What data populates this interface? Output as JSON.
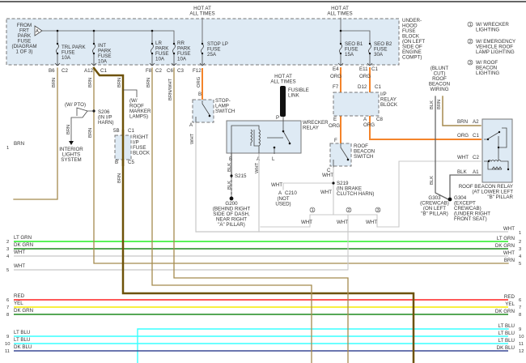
{
  "colors": {
    "brn": "#a58a4e",
    "brn_thick": "#6e5208",
    "org": "#f4842a",
    "wht": "#c8c8c8",
    "lt_grn": "#22ee22",
    "dk_grn": "#1f8a1f",
    "red": "#ff2020",
    "yel": "#f6ea00",
    "lt_blu": "#38ffff",
    "dk_blu": "#3a4896",
    "blk": "#555555",
    "box_fill": "#deeaf4"
  },
  "hot_labels": {
    "stop": [
      "HOT AT",
      "ALL TIMES"
    ],
    "seo": [
      "HOT AT",
      "ALL TIMES"
    ],
    "fusible": [
      "HOT AT",
      "ALL TIMES"
    ]
  },
  "fuse_block": {
    "from_label": [
      "FROM",
      "FRT",
      "PARK",
      "FUSE",
      "(DIAGRAM",
      "1 OF 3)"
    ],
    "triangle": "A",
    "underhood_label": [
      "UNDER-",
      "HOOD",
      "FUSE",
      "BLOCK",
      "(ON LEFT",
      "SIDE OF",
      "ENGINE",
      "COMPT)"
    ],
    "fuses": {
      "trl": [
        "TRL PARK",
        "FUSE",
        "10A"
      ],
      "int": [
        "INT",
        "PARK",
        "FUSE",
        "10A"
      ],
      "lr": [
        "LR",
        "PARK",
        "FUSE",
        "10A"
      ],
      "rr": [
        "RR",
        "PARK",
        "FUSE",
        "10A"
      ],
      "stop": [
        "STOP LP",
        "FUSE",
        "25A"
      ],
      "seo_b1": [
        "SEO B1",
        "FUSE",
        "15A"
      ],
      "seo_b2": [
        "SEO B2",
        "FUSE",
        "30A"
      ]
    },
    "pins": {
      "trl": [
        "B6",
        "C2"
      ],
      "int": [
        "A12",
        "C1"
      ],
      "lr": [
        "F8",
        "C2"
      ],
      "rr": [
        "C6",
        "C3"
      ],
      "stop": "F12",
      "seo_b1": "E4",
      "seo_b2": [
        "E11",
        "C1"
      ]
    }
  },
  "legend": [
    {
      "num": "1",
      "text": [
        "W/ WRECKER",
        "LIGHTING"
      ]
    },
    {
      "num": "2",
      "text": [
        "W/ EMERGENCY",
        "VEHICLE ROOF",
        "LAMP LIGHTING"
      ]
    },
    {
      "num": "3",
      "text": [
        "W/ ROOF",
        "BEACON",
        "LIGHTING"
      ]
    }
  ],
  "wire_labels": {
    "brn": "BRN",
    "brn_wht": "BRN/WHT",
    "org": "ORG",
    "wht": "WHT",
    "blk": "BLK"
  },
  "components": {
    "w_pto": "(W/ PTO)",
    "s206": [
      "S206",
      "(IN I/P",
      "HARN)"
    ],
    "interior": [
      "INTERIOR",
      "LIGHTS",
      "SYSTEM"
    ],
    "roof_marker": [
      "(W/",
      "ROOF",
      "MARKER",
      "LAMPS)"
    ],
    "right_ip_fuse": [
      "RIGHT",
      "I/P",
      "FUSE",
      "BLOCK"
    ],
    "right_ip_pins": [
      "5B",
      "C1",
      "B",
      "C5"
    ],
    "stop_lamp_switch": [
      "STOP-",
      "LAMP",
      "SWITCH"
    ],
    "stop_pins": [
      "B",
      "A"
    ],
    "fusible_link": [
      "FUSIBLE",
      "LINK"
    ],
    "fusible_pin": "P",
    "wrecker_relay": [
      "WRECKER",
      "RELAY"
    ],
    "wrecker_pins": [
      "B",
      "A",
      "L"
    ],
    "s215": "S215",
    "g200": [
      "G200",
      "(BEHIND RIGHT",
      "SIDE OF DASH,",
      "NEAR RIGHT",
      "\"A\" PILLAR)"
    ],
    "ip_relay_block": [
      "I/P",
      "RELAY",
      "BLOCK"
    ],
    "ip_relay_pins": [
      "F7",
      "D12",
      "C1",
      "E",
      "A",
      "C8"
    ],
    "roof_beacon_switch": [
      "ROOF",
      "BEACON",
      "SWITCH"
    ],
    "beacon_switch_pins": [
      "F",
      "C"
    ],
    "s219": [
      "S219",
      "(IN BRAKE",
      "CLUTCH HARN)"
    ],
    "c210": [
      "A",
      "C210",
      "(NOT",
      "USED)"
    ],
    "branch_nums": [
      "1",
      "2",
      "3"
    ],
    "blunt_cut": [
      "(BLUNT",
      "CUT)",
      "ROOF",
      "BEACON",
      "WIRING"
    ],
    "roof_beacon_relay": [
      "ROOF BEACON RELAY",
      "(AT LOWER LEFT",
      "\"B\" PILLAR"
    ],
    "relay_pins": [
      "A2",
      "C1",
      "C2",
      "A1"
    ],
    "g303": [
      "G303",
      "(CREWCAB)",
      "(ON LEFT",
      "\"B\" PILLAR)"
    ],
    "g304": [
      "G304",
      "(EXCEPT",
      "CREWCAB)",
      "(UNDER RIGHT",
      "FRONT SEAT)"
    ]
  },
  "bus_left": [
    {
      "num": "1",
      "color": "BRN"
    },
    {
      "num": "2",
      "color": "LT GRN"
    },
    {
      "num": "3",
      "color": "DK GRN"
    },
    {
      "num": "4",
      "color": "WHT"
    },
    {
      "num": "5",
      "color": "WHT"
    },
    {
      "num": "6",
      "color": "RED"
    },
    {
      "num": "7",
      "color": "YEL"
    },
    {
      "num": "8",
      "color": "DK GRN"
    },
    {
      "num": "9",
      "color": "LT BLU"
    },
    {
      "num": "10",
      "color": "LT BLU"
    },
    {
      "num": "11",
      "color": "DK BLU"
    }
  ],
  "bus_right": [
    {
      "num": "1",
      "color": "WHT"
    },
    {
      "num": "2",
      "color": "LT GRN"
    },
    {
      "num": "3",
      "color": "DK GRN"
    },
    {
      "num": "4",
      "color": "WHT"
    },
    {
      "num": "5",
      "color": "BRN"
    },
    {
      "num": "6",
      "color": "RED"
    },
    {
      "num": "7",
      "color": "YEL"
    },
    {
      "num": "8",
      "color": "DK GRN"
    },
    {
      "num": "9",
      "color": "LT BLU"
    },
    {
      "num": "10",
      "color": "LT BLU"
    },
    {
      "num": "11",
      "color": "LT BLU"
    },
    {
      "num": "12",
      "color": "DK BLU"
    }
  ]
}
